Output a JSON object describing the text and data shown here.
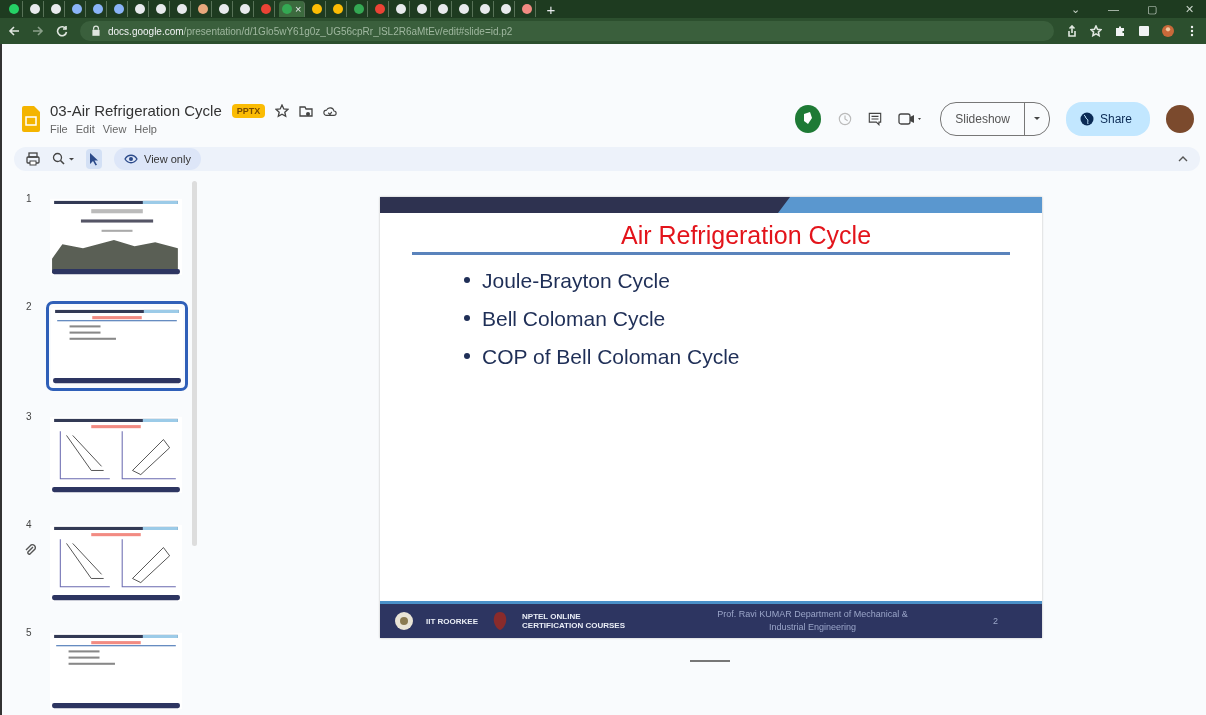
{
  "browser": {
    "tabs": [
      {
        "color": "#25d366",
        "selected": false
      },
      {
        "color": "#e8eaed",
        "selected": false
      },
      {
        "color": "#e8eaed",
        "selected": false
      },
      {
        "color": "#8ab4f8",
        "selected": false
      },
      {
        "color": "#8ab4f8",
        "selected": false
      },
      {
        "color": "#8ab4f8",
        "selected": false
      },
      {
        "color": "#e8eaed",
        "selected": false
      },
      {
        "color": "#e8eaed",
        "selected": false
      },
      {
        "color": "#e8eaed",
        "selected": false
      },
      {
        "color": "#e8a87c",
        "selected": false
      },
      {
        "color": "#e8eaed",
        "selected": false
      },
      {
        "color": "#e8eaed",
        "selected": false
      },
      {
        "color": "#ea4335",
        "selected": false
      },
      {
        "color": "#34a853",
        "selected": true
      },
      {
        "color": "#fbbc04",
        "selected": false
      },
      {
        "color": "#fbbc04",
        "selected": false
      },
      {
        "color": "#34a853",
        "selected": false
      },
      {
        "color": "#ea4335",
        "selected": false
      },
      {
        "color": "#e8eaed",
        "selected": false
      },
      {
        "color": "#e8eaed",
        "selected": false
      },
      {
        "color": "#e8eaed",
        "selected": false
      },
      {
        "color": "#e8eaed",
        "selected": false
      },
      {
        "color": "#e8eaed",
        "selected": false
      },
      {
        "color": "#e8eaed",
        "selected": false
      },
      {
        "color": "#f28b82",
        "selected": false
      }
    ],
    "close_tab": "×",
    "new_tab": "+",
    "window_controls": [
      "⌄",
      "—",
      "▢",
      "✕"
    ],
    "url_host": "docs.google.com",
    "url_path": "/presentation/d/1Glo5wY61g0z_UG56cpRr_lSL2R6aMtEv/edit#slide=id.p2"
  },
  "document": {
    "title": "03-Air Refrigeration Cycle",
    "badge": "PPTX",
    "menu": [
      "File",
      "Edit",
      "View",
      "Help"
    ],
    "slideshow": "Slideshow",
    "share": "Share",
    "view_only": "View only"
  },
  "filmstrip": [
    {
      "number": "1",
      "kind": "title",
      "selected": false
    },
    {
      "number": "2",
      "kind": "bullets",
      "selected": true
    },
    {
      "number": "3",
      "kind": "diagram",
      "selected": false
    },
    {
      "number": "4",
      "kind": "diagram",
      "selected": false
    },
    {
      "number": "5",
      "kind": "bullets",
      "selected": false
    }
  ],
  "slide": {
    "title": "Air Refrigeration Cycle",
    "bullets": [
      "Joule-Brayton Cycle",
      "Bell Coloman Cycle",
      "COP of Bell Coloman Cycle"
    ],
    "footer": {
      "institute": "IIT ROORKEE",
      "course": "NPTEL ONLINE CERTIFICATION COURSES",
      "credit": [
        "Prof. Ravi KUMAR Department of Mechanical &",
        "Industrial Engineering"
      ],
      "page": "2"
    }
  }
}
